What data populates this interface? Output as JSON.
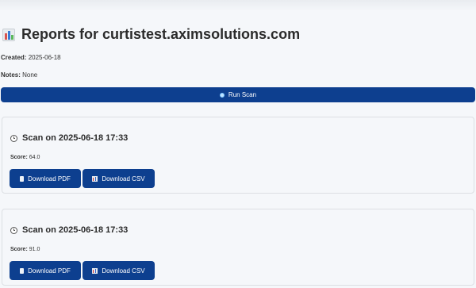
{
  "header": {
    "title": "Reports for curtistest.aximsolutions.com"
  },
  "meta": {
    "created_label": "Created:",
    "created_value": "2025-06-18",
    "notes_label": "Notes:",
    "notes_value": "None"
  },
  "actions": {
    "run_scan_label": "Run Scan"
  },
  "scans": [
    {
      "title": "Scan on 2025-06-18 17:33",
      "score_label": "Score:",
      "score_value": "64.0",
      "pdf_label": "Download PDF",
      "csv_label": "Download CSV"
    },
    {
      "title": "Scan on 2025-06-18 17:33",
      "score_label": "Score:",
      "score_value": "91.0",
      "pdf_label": "Download PDF",
      "csv_label": "Download CSV"
    }
  ],
  "colors": {
    "primary": "#0d3f8f",
    "background": "#f5f7fa",
    "card_border": "#dcdfe3"
  },
  "icons": {
    "title": "bar-chart-icon",
    "run": "magnifier-icon",
    "scan": "clock-icon",
    "pdf": "document-icon",
    "csv": "bar-chart-icon"
  }
}
